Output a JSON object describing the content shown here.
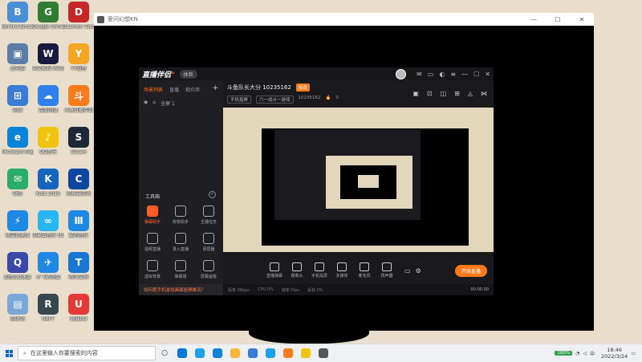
{
  "desktop": {
    "icons": [
      {
        "label": "Bkmkd Bmark",
        "color": "#4a8fd8",
        "glyph": "B"
      },
      {
        "label": "Google Chrome",
        "color": "#2e7d32",
        "glyph": "G"
      },
      {
        "label": "Daemon Tools Lite",
        "color": "#c62828",
        "glyph": "D"
      },
      {
        "label": "此电脑",
        "color": "#5a7ea8",
        "glyph": "▣"
      },
      {
        "label": "英文影视 WeGame版",
        "color": "#1a1a40",
        "glyph": "W"
      },
      {
        "label": "YY语音",
        "color": "#f5a623",
        "glyph": "Y"
      },
      {
        "label": "网络",
        "color": "#3a7bd5",
        "glyph": "⊞"
      },
      {
        "label": "百度网盘",
        "color": "#2f80ed",
        "glyph": "☁"
      },
      {
        "label": "斗鱼直播伴侣",
        "color": "#ff7a1a",
        "glyph": "斗"
      },
      {
        "label": "Microsoft Edge",
        "color": "#0a84d8",
        "glyph": "e"
      },
      {
        "label": "QQ音乐",
        "color": "#f2c40f",
        "glyph": "♪"
      },
      {
        "label": "Steam",
        "color": "#1b2838",
        "glyph": "S"
      },
      {
        "label": "微信",
        "color": "#2aae67",
        "glyph": "✉"
      },
      {
        "label": "Kodi 2015",
        "color": "#1565c0",
        "glyph": "K"
      },
      {
        "label": "网易云游戏",
        "color": "#0d47a1",
        "glyph": "C"
      },
      {
        "label": "迅雷极速版",
        "color": "#1e88e5",
        "glyph": "⚡"
      },
      {
        "label": "网易云音乐 UU加速器",
        "color": "#29b6f6",
        "glyph": "∞"
      },
      {
        "label": "酷狗音乐",
        "color": "#1e88e5",
        "glyph": "Ⅲ"
      },
      {
        "label": "超级QQ速度",
        "color": "#3949ab",
        "glyph": "Q"
      },
      {
        "label": "小飞机网盘",
        "color": "#1e88e5",
        "glyph": "✈"
      },
      {
        "label": "腾讯文档",
        "color": "#1976d2",
        "glyph": "T"
      },
      {
        "label": "回收站",
        "color": "#7aa7d8",
        "glyph": "▤"
      },
      {
        "label": "RAFT",
        "color": "#37474f",
        "glyph": "R"
      },
      {
        "label": "网易UU",
        "color": "#e53935",
        "glyph": "U"
      }
    ]
  },
  "viewer": {
    "title": "爱问幻想KN",
    "controls": [
      "—",
      "☐",
      "✕"
    ]
  },
  "app": {
    "logo": "直播伴侣",
    "version_pill": "体验",
    "sidebar_tabs": [
      "场景列表",
      "直播",
      "观众席"
    ],
    "add_label": "+",
    "scene_label": "全屏 1",
    "tools_title": "工具箱",
    "tools": [
      {
        "label": "弹幕助手",
        "hot": true
      },
      {
        "label": "房管助手",
        "hot": false
      },
      {
        "label": "主播任务",
        "hot": false
      },
      {
        "label": "视频直播",
        "hot": false
      },
      {
        "label": "录入直播",
        "hot": false
      },
      {
        "label": "录屏器",
        "hot": false
      },
      {
        "label": "虚拟背景",
        "hot": false
      },
      {
        "label": "弹幕墙",
        "hot": false
      },
      {
        "label": "屏幕画笔",
        "hot": false
      }
    ],
    "tip": "如何把手机游戏画面投屏推流？",
    "room_title": "斗鱼队长大分 10235162",
    "edit_label": "修改",
    "room_sub": [
      "手机投屏",
      "六一战斗一游戏",
      "10235162"
    ],
    "room_hot": "0",
    "bottom_buttons": [
      "直播弹幕",
      "摄像头",
      "手机投屏",
      "多媒体",
      "麦克风",
      "扬声器"
    ],
    "start_live": "开始直播",
    "status": [
      "码率 0Kbps",
      "CPU 0%",
      "帧率 0fps",
      "丢帧 0%"
    ],
    "status_time": "00:00:00"
  },
  "taskbar": {
    "search_placeholder": "在这里输入你要搜索的内容",
    "apps": [
      "#0078d7",
      "#1aa3e8",
      "#0a84d8",
      "#f5b63a",
      "#3a7bd5",
      "#1aa3e8",
      "#ff7a1a",
      "#f2c40f",
      "#555555"
    ],
    "battery": "100%",
    "ime": "中",
    "time": "18:46",
    "date": "2022/3/24"
  }
}
